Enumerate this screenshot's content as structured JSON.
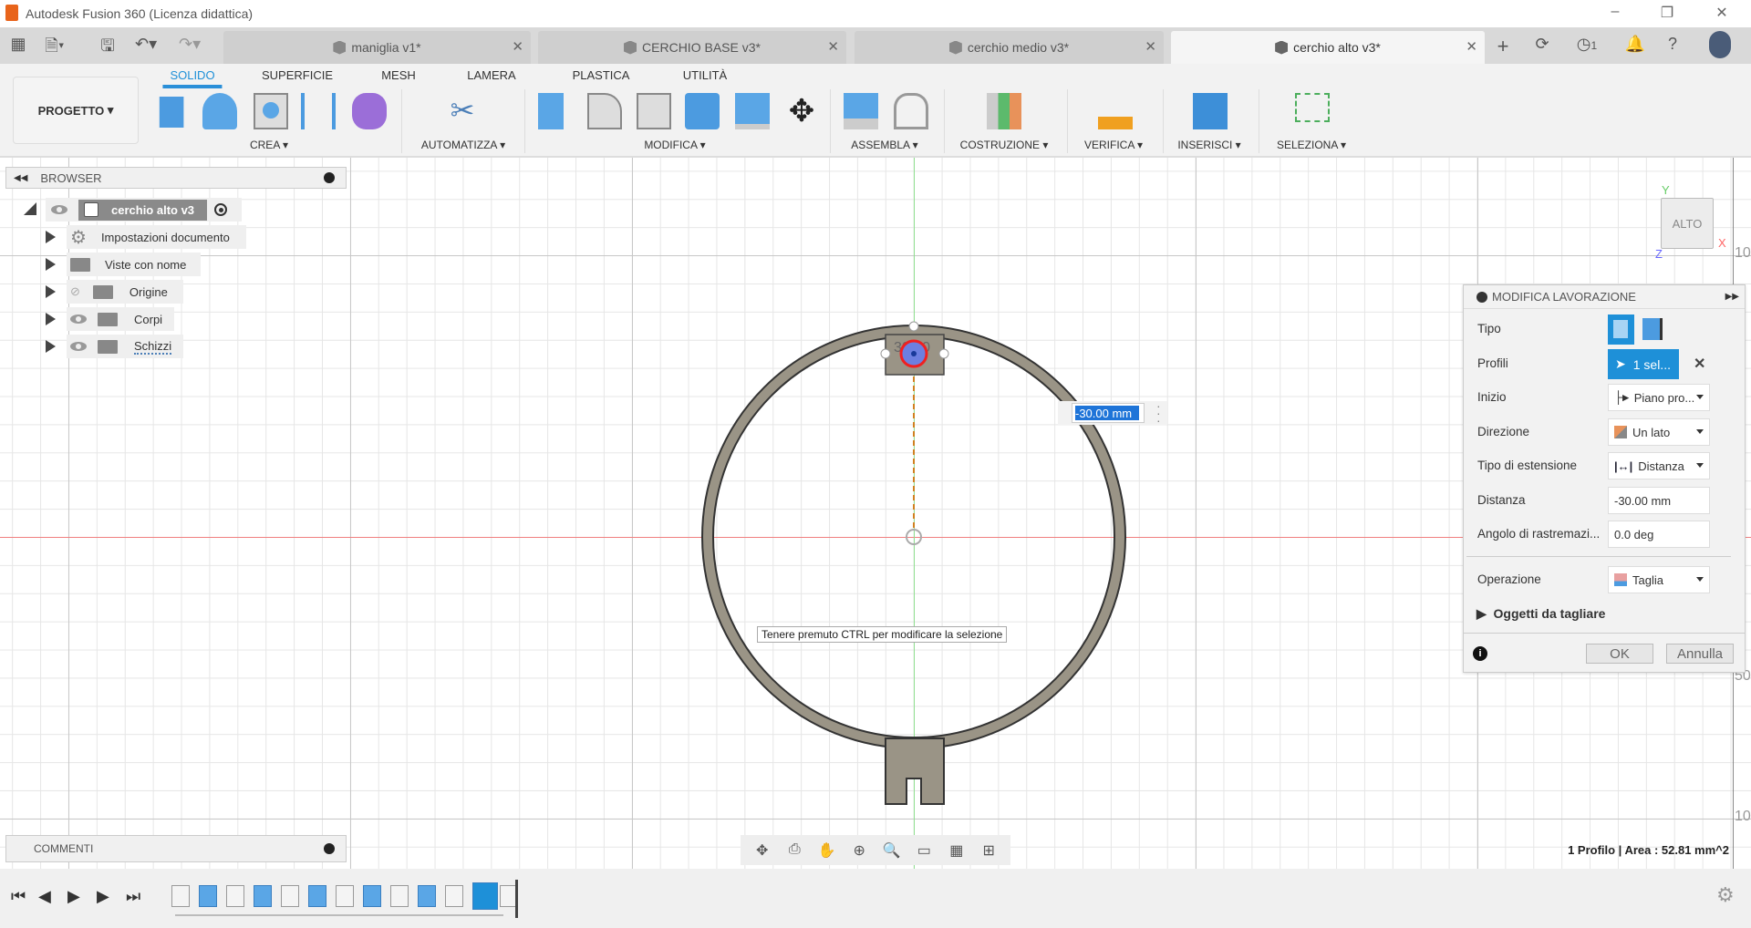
{
  "window": {
    "title": "Autodesk Fusion 360 (Licenza didattica)"
  },
  "tabs": [
    {
      "label": "maniglia v1*",
      "active": false
    },
    {
      "label": "CERCHIO BASE v3*",
      "active": false
    },
    {
      "label": "cerchio medio v3*",
      "active": false
    },
    {
      "label": "cerchio alto v3*",
      "active": true
    }
  ],
  "tabbar": {
    "notifications_count": "1",
    "icons": [
      "grid-icon",
      "file-icon",
      "save-icon",
      "undo-icon",
      "redo-icon",
      "add-tab-icon",
      "refresh-icon",
      "clock-icon",
      "bell-icon",
      "help-icon",
      "avatar"
    ]
  },
  "toolbar": {
    "project_label": "PROGETTO",
    "tabs": [
      "SOLIDO",
      "SUPERFICIE",
      "MESH",
      "LAMERA",
      "PLASTICA",
      "UTILITÀ"
    ],
    "active_tab": "SOLIDO",
    "groups": [
      "CREA",
      "AUTOMATIZZA",
      "MODIFICA",
      "ASSEMBLA",
      "COSTRUZIONE",
      "VERIFICA",
      "INSERISCI",
      "SELEZIONA"
    ]
  },
  "browser": {
    "title": "BROWSER",
    "root": "cerchio alto v3",
    "items": [
      "Impostazioni documento",
      "Viste con nome",
      "Origine",
      "Corpi",
      "Schizzi"
    ]
  },
  "comments": {
    "title": "COMMENTI"
  },
  "viewport": {
    "dimension_input": "-30.00 mm",
    "sketch_label": "30.00",
    "tooltip": "Tenere premuto CTRL per modificare la selezione",
    "viewcube": "ALTO",
    "axis_labels": {
      "x": "X",
      "y": "Y",
      "z": "Z"
    },
    "ruler_labels": [
      "10",
      "50",
      "10"
    ],
    "status": "1 Profilo | Area : 52.81 mm^2",
    "accent": "#1e90d8"
  },
  "panel": {
    "title": "MODIFICA LAVORAZIONE",
    "rows": {
      "tipo": "Tipo",
      "profili": "Profili",
      "profili_value": "1 sel...",
      "inizio": "Inizio",
      "inizio_value": "Piano pro...",
      "direzione": "Direzione",
      "direzione_value": "Un lato",
      "tipo_estensione": "Tipo di estensione",
      "tipo_estensione_value": "Distanza",
      "distanza": "Distanza",
      "distanza_value": "-30.00 mm",
      "angolo": "Angolo di rastremazi...",
      "angolo_value": "0.0 deg",
      "operazione": "Operazione",
      "operazione_value": "Taglia",
      "oggetti": "Oggetti da tagliare"
    },
    "ok": "OK",
    "cancel": "Annulla"
  },
  "timeline": {
    "features": 13,
    "active_index": 11
  }
}
